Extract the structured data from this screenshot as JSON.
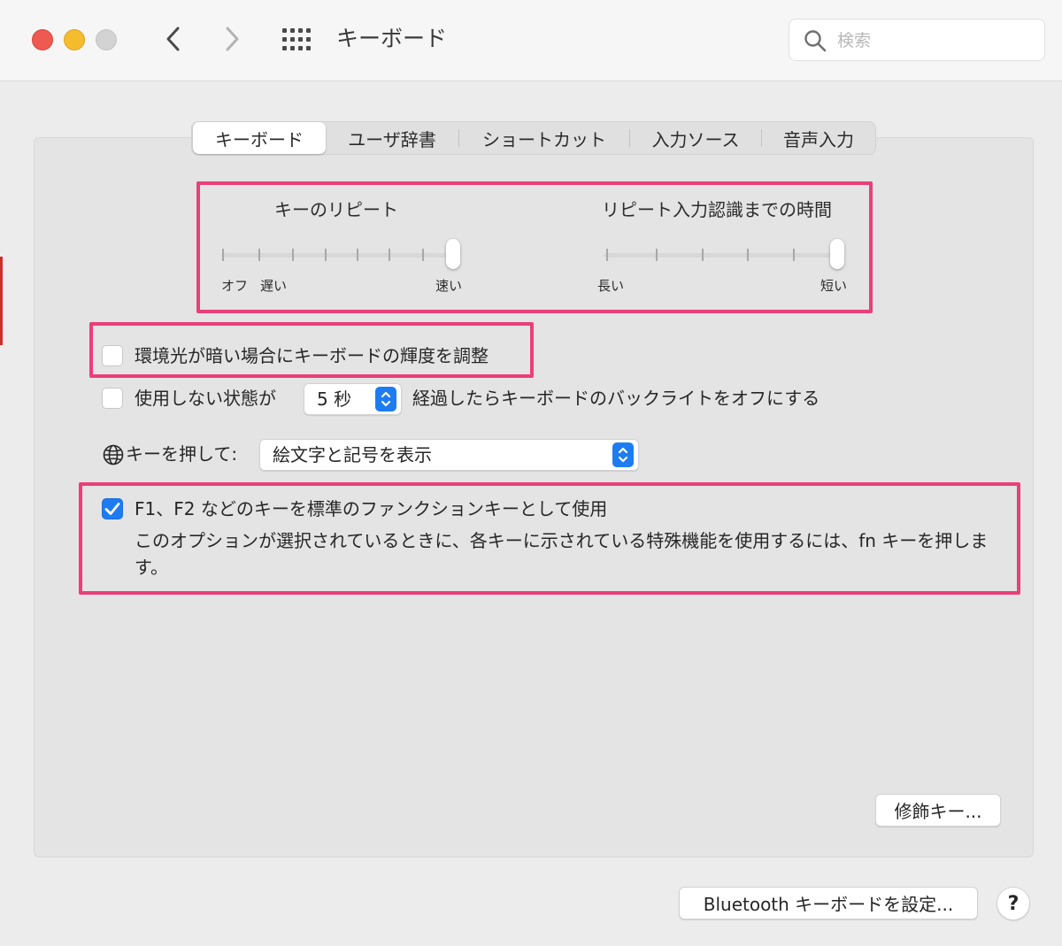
{
  "window": {
    "title": "キーボード",
    "search_placeholder": "検索"
  },
  "tabs": [
    {
      "label": "キーボード",
      "active": true
    },
    {
      "label": "ユーザ辞書",
      "active": false
    },
    {
      "label": "ショートカット",
      "active": false
    },
    {
      "label": "入力ソース",
      "active": false
    },
    {
      "label": "音声入力",
      "active": false
    }
  ],
  "sliders": {
    "key_repeat": {
      "title": "キーのリピート",
      "label_off": "オフ",
      "label_slow": "遅い",
      "label_fast": "速い",
      "value_fraction": 1.0
    },
    "delay": {
      "title": "リピート入力認識までの時間",
      "label_long": "長い",
      "label_short": "短い",
      "value_fraction": 1.0
    }
  },
  "options": {
    "brightness": {
      "label": "環境光が暗い場合にキーボードの輝度を調整",
      "checked": false
    },
    "backlight": {
      "label_before": "使用しない状態が",
      "timeout_value": "5 秒",
      "label_after": "経過したらキーボードのバックライトをオフにする",
      "checked": false
    },
    "globe_key": {
      "label": "キーを押して:",
      "value": "絵文字と記号を表示"
    },
    "fn_keys": {
      "label": "F1、F2 などのキーを標準のファンクションキーとして使用",
      "description": "このオプションが選択されているときに、各キーに示されている特殊機能を使用するには、fn キーを押します。",
      "checked": true
    }
  },
  "buttons": {
    "modifier_keys": "修飾キー...",
    "bluetooth_setup": "Bluetooth キーボードを設定...",
    "help": "?"
  },
  "colors": {
    "accent": "#1e7cf2",
    "highlight": "#ea3f79"
  }
}
